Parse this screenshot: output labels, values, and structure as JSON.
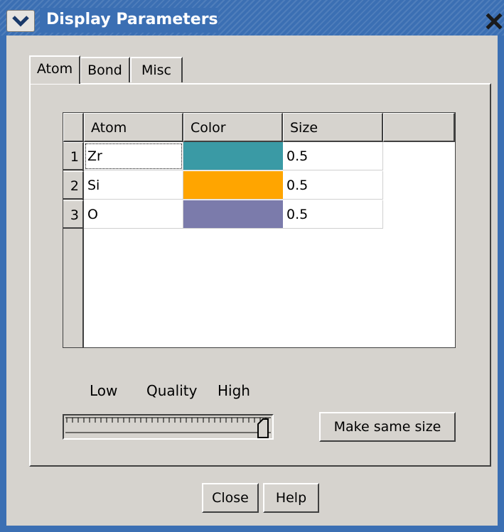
{
  "window": {
    "title": "Display Parameters",
    "menu_icon": "chevron-down-icon",
    "close_icon": "close-icon",
    "frame_color": "#3b6fb3"
  },
  "tabs": [
    {
      "label": "Atom",
      "active": true
    },
    {
      "label": "Bond",
      "active": false
    },
    {
      "label": "Misc",
      "active": false
    }
  ],
  "table": {
    "columns": [
      "Atom",
      "Color",
      "Size",
      ""
    ],
    "rows": [
      {
        "num": "1",
        "atom": "Zr",
        "color": "#3a9aa5",
        "size": "0.5"
      },
      {
        "num": "2",
        "atom": "Si",
        "color": "#ffa500",
        "size": "0.5"
      },
      {
        "num": "3",
        "atom": "O",
        "color": "#7b7bab",
        "size": "0.5"
      }
    ]
  },
  "quality": {
    "low_label": "Low",
    "label": "Quality",
    "high_label": "High",
    "value_fraction": 1.0
  },
  "buttons": {
    "make_same_size": "Make same size",
    "close": "Close",
    "help": "Help"
  }
}
